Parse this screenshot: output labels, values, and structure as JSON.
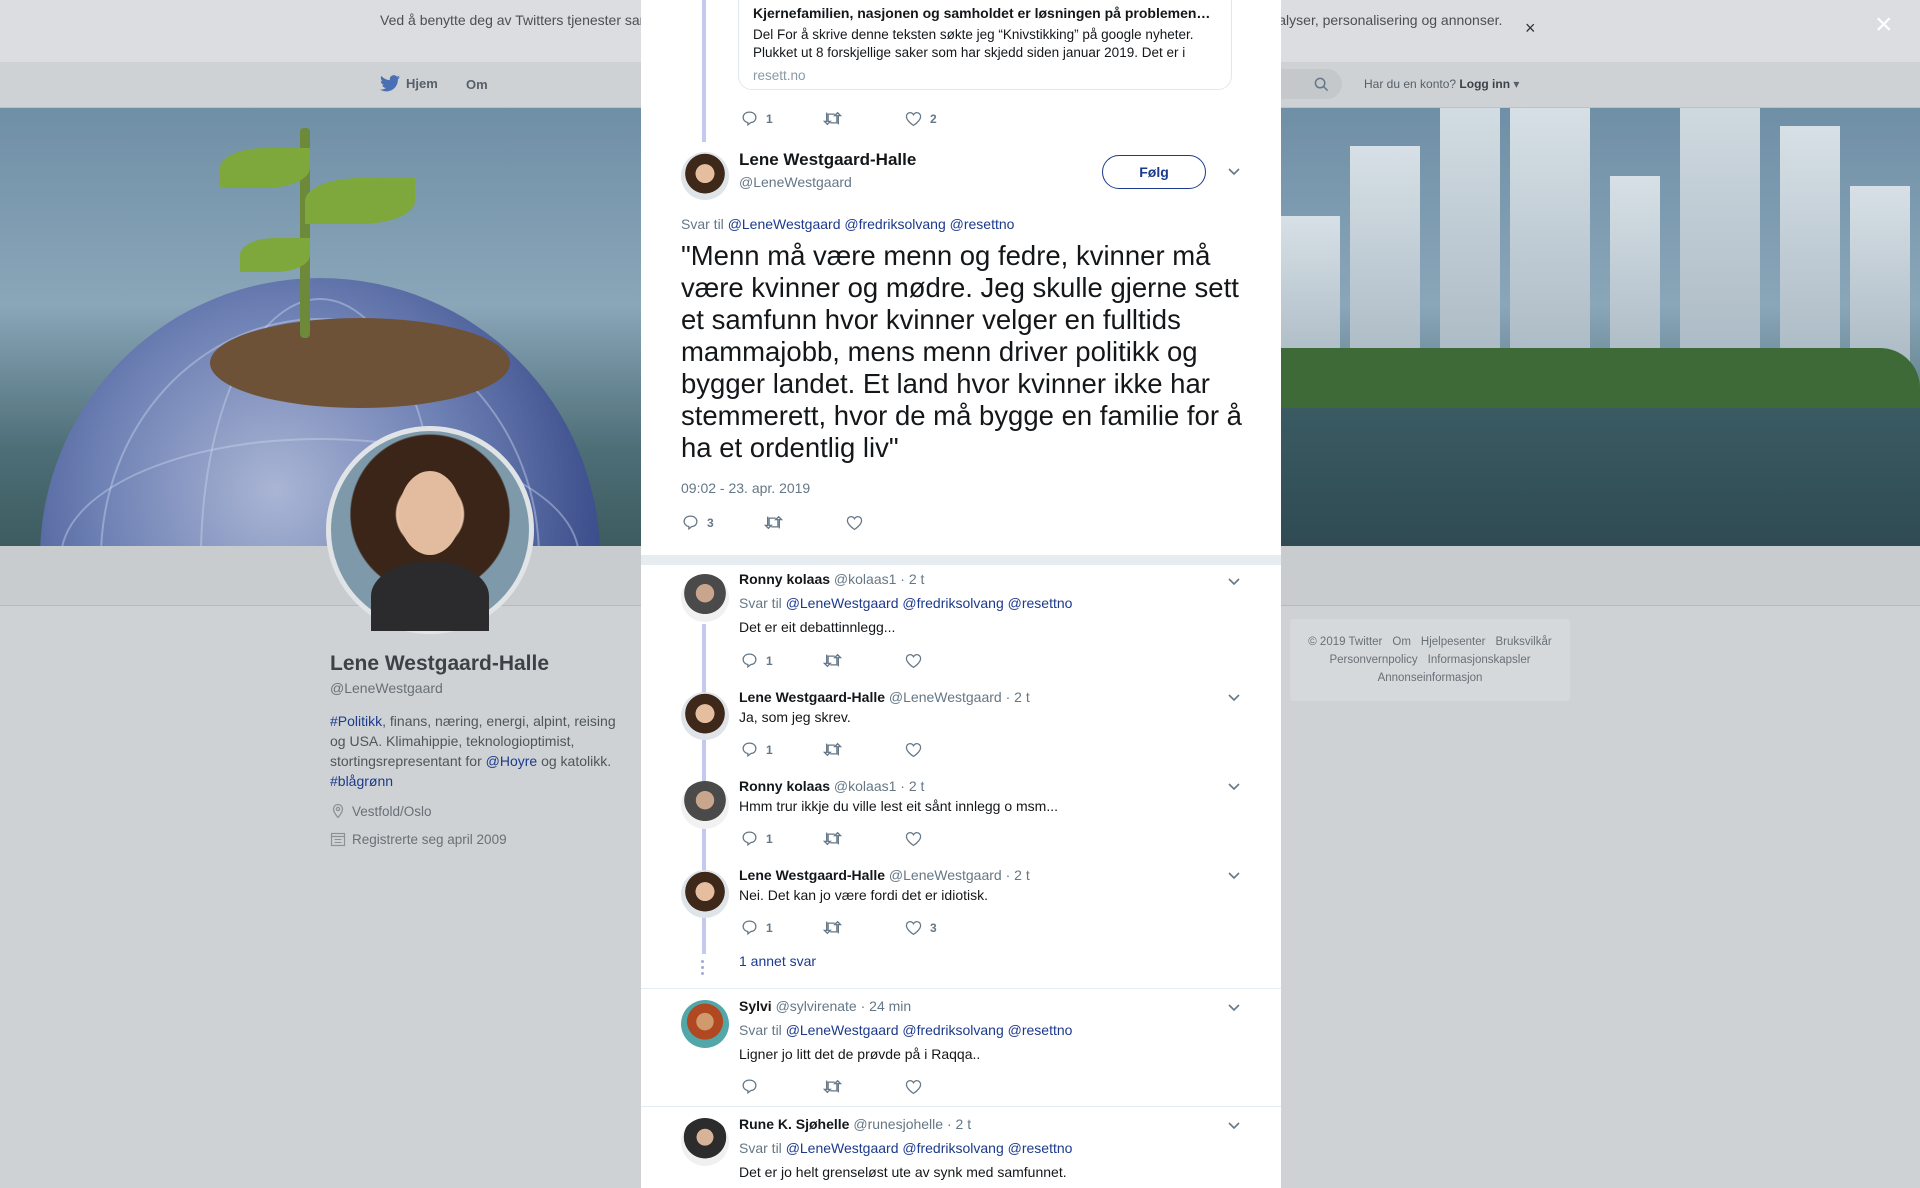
{
  "cookie_banner": {
    "text": "Ved å benytte deg av Twitters tjenester samtykker du i vår bruk av informasjonskapsler. Vi og våre partnere bruker informasjonskapsler til bl.a. analyser, personalisering og annonser.",
    "close": "×"
  },
  "overlay_close": "×",
  "nav": {
    "home": "Hjem",
    "about": "Om",
    "login_prompt": "Har du en konto?",
    "login": "Logg inn"
  },
  "profile": {
    "name": "Lene Westgaard-Halle",
    "handle": "@LeneWestgaard",
    "bio_parts": [
      "#Politikk",
      ", finans, næring, energi, alpint, reising og USA. Klimahippie, teknologioptimist, stortingsrepresentant for ",
      "@Hoyre",
      " og katolikk. ",
      "#blågrønn"
    ],
    "location": "Vestfold/Oslo",
    "joined": "Registrerte seg april 2009"
  },
  "footer": {
    "links": [
      "© 2019 Twitter",
      "Om",
      "Hjelpesenter",
      "Bruksvilkår",
      "Personvernpolicy",
      "Informasjonskapsler",
      "Annonseinformasjon"
    ]
  },
  "prev_tweet": {
    "card_title": "Kjernefamilien, nasjonen og samholdet er løsningen på problemene …",
    "card_desc": "Del For å skrive denne teksten søkte jeg “Knivstikking” på google nyheter. Plukket ut 8 forskjellige saker som har skjedd siden januar 2019. Det er i",
    "card_domain": "resett.no",
    "replies": "1",
    "likes": "2"
  },
  "main_tweet": {
    "name": "Lene Westgaard-Halle",
    "handle": "@LeneWestgaard",
    "follow": "Følg",
    "reply_prefix": "Svar til",
    "mentions": "@LeneWestgaard @fredriksolvang @resettno",
    "text": "\"Menn må være menn og fedre, kvinner må være kvinner og mødre. Jeg skulle gjerne sett et samfunn hvor kvinner velger en fulltids mammajobb, mens menn driver politikk og bygger landet. Et land hvor kvinner ikke har stemmerett, hvor de må bygge en familie for å ha et ordentlig liv\"",
    "timestamp": "09:02 - 23. apr. 2019",
    "replies": "3"
  },
  "replies": [
    {
      "name": "Ronny kolaas",
      "handle": "@kolaas1",
      "time": "· 2 t",
      "reply_prefix": "Svar til",
      "mentions": "@LeneWestgaard @fredriksolvang @resettno",
      "text": "Det er eit debattinnlegg...",
      "replies": "1",
      "likes": ""
    },
    {
      "name": "Lene Westgaard-Halle",
      "handle": "@LeneWestgaard",
      "time": "· 2 t",
      "text": "Ja, som jeg skrev.",
      "replies": "1",
      "likes": ""
    },
    {
      "name": "Ronny kolaas",
      "handle": "@kolaas1",
      "time": "· 2 t",
      "text": "Hmm trur ikkje du ville lest eit sånt innlegg o msm...",
      "replies": "1",
      "likes": ""
    },
    {
      "name": "Lene Westgaard-Halle",
      "handle": "@LeneWestgaard",
      "time": "· 2 t",
      "text": "Nei. Det kan jo være fordi det er idiotisk.",
      "replies": "1",
      "likes": "3"
    },
    {
      "name": "Sylvi",
      "handle": "@sylvirenate",
      "time": "· 24 min",
      "reply_prefix": "Svar til",
      "mentions": "@LeneWestgaard @fredriksolvang @resettno",
      "text": "Ligner jo litt det de prøvde på i Raqqa..",
      "replies": "",
      "likes": ""
    },
    {
      "name": "Rune K. Sjøhelle",
      "handle": "@runesjohelle",
      "time": "· 2 t",
      "reply_prefix": "Svar til",
      "mentions": "@LeneWestgaard @fredriksolvang @resettno",
      "text": "Det er jo helt grenseløst ute av synk med samfunnet."
    }
  ],
  "more_replies": "1 annet svar",
  "colors": {
    "accent": "#1c3a8c",
    "thread_line": "#c5c8ef",
    "muted": "#657786"
  }
}
